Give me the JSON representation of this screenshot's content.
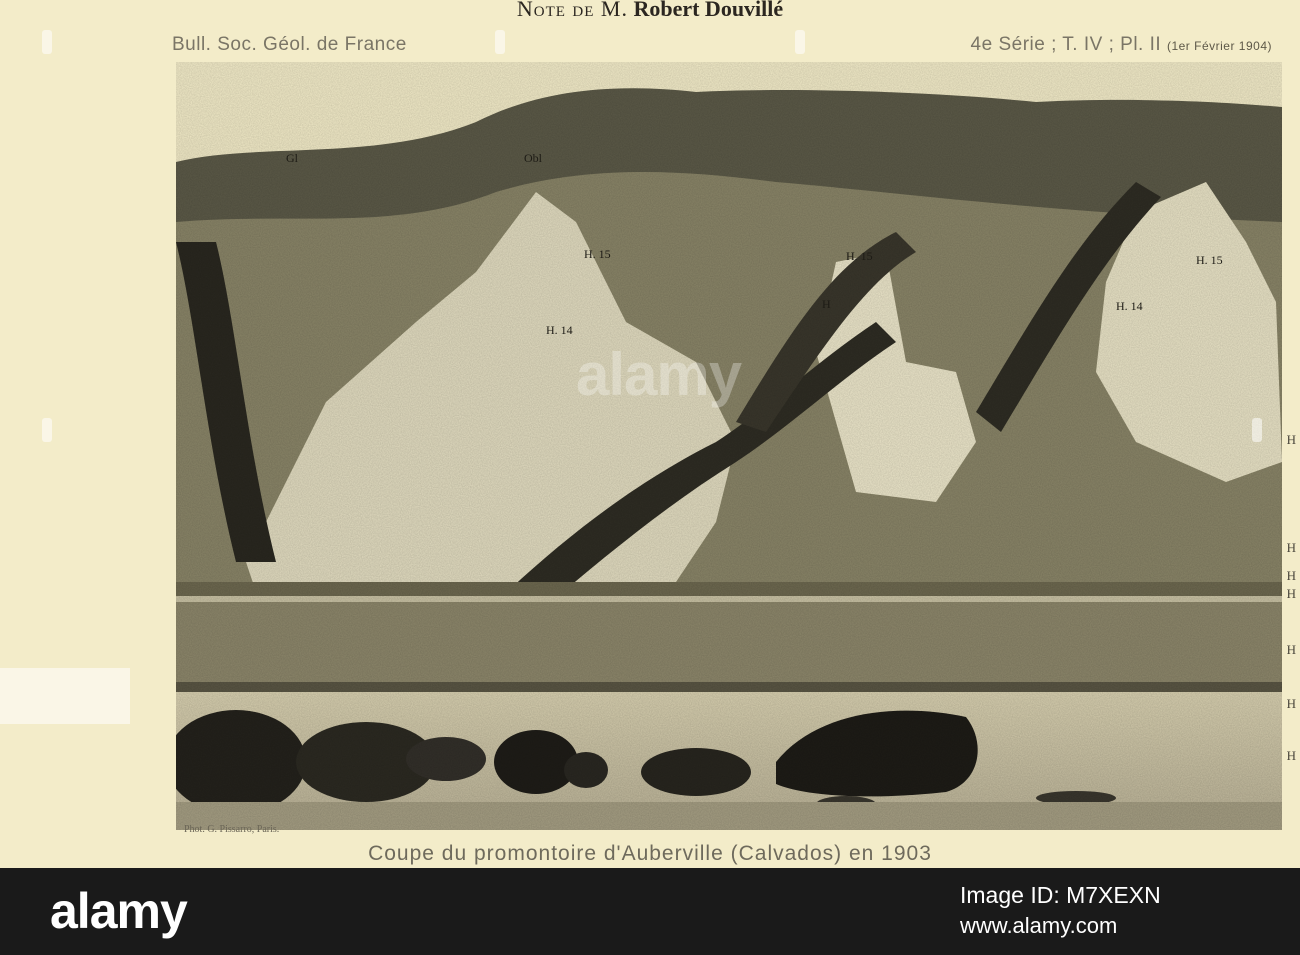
{
  "header": {
    "note_prefix": "Note de M.",
    "author": "Robert Douvillé",
    "bulletin": "Bull. Soc. Géol. de France",
    "series": "4e Série ; T. IV ; Pl. II",
    "date": "(1er Février 1904)"
  },
  "photo": {
    "credit": "Phot. G. Pissarro, Paris.",
    "layer_labels": [
      "Gl",
      "Obl",
      "H. 15",
      "H. 14",
      "H. 15",
      "H",
      "H. 14",
      "H. 15"
    ]
  },
  "caption": "Coupe du promontoire d'Auberville (Calvados) en 1903",
  "margin_labels": [
    "H",
    "H",
    "H",
    "H",
    "H",
    "H",
    "H"
  ],
  "stock_bar": {
    "logo": "alamy",
    "image_id": "Image ID: M7XEXN",
    "url": "www.alamy.com"
  },
  "watermark": {
    "text": "alamy"
  },
  "colors": {
    "paper": "#f3ecc9",
    "bar": "#1a1a1a",
    "ink": "#2a2720"
  }
}
